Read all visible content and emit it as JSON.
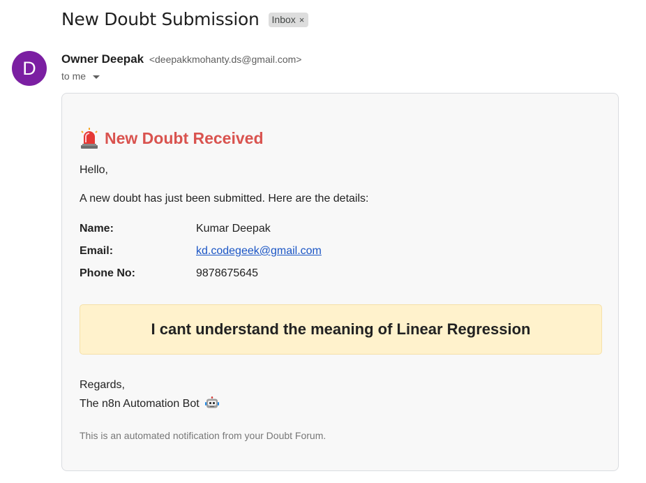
{
  "email": {
    "subject": "New Doubt Submission",
    "label_chip": "Inbox",
    "label_chip_remove": "×",
    "sender": {
      "avatar_letter": "D",
      "name": "Owner Deepak",
      "address": "<deepakkmohanty.ds@gmail.com>",
      "recipient": "to me"
    }
  },
  "body": {
    "heading": "New Doubt Received",
    "heading_icon": "siren-icon",
    "greeting": "Hello,",
    "intro": "A new doubt has just been submitted. Here are the details:",
    "details": [
      {
        "label": "Name:",
        "value": "Kumar Deepak"
      },
      {
        "label": "Email:",
        "value": "kd.codegeek@gmail.com"
      },
      {
        "label": "Phone No:",
        "value": "9878675645"
      }
    ],
    "question": "I cant understand the meaning of Linear Regression",
    "signoff": "Regards,",
    "signature": "The n8n Automation Bot",
    "signature_icon": "robot-icon",
    "footer": "This is an automated notification from your Doubt Forum."
  },
  "colors": {
    "heading": "#d9534f",
    "avatar": "#7b1fa2",
    "link": "#1a55c5",
    "question_bg": "#fff2cc"
  }
}
